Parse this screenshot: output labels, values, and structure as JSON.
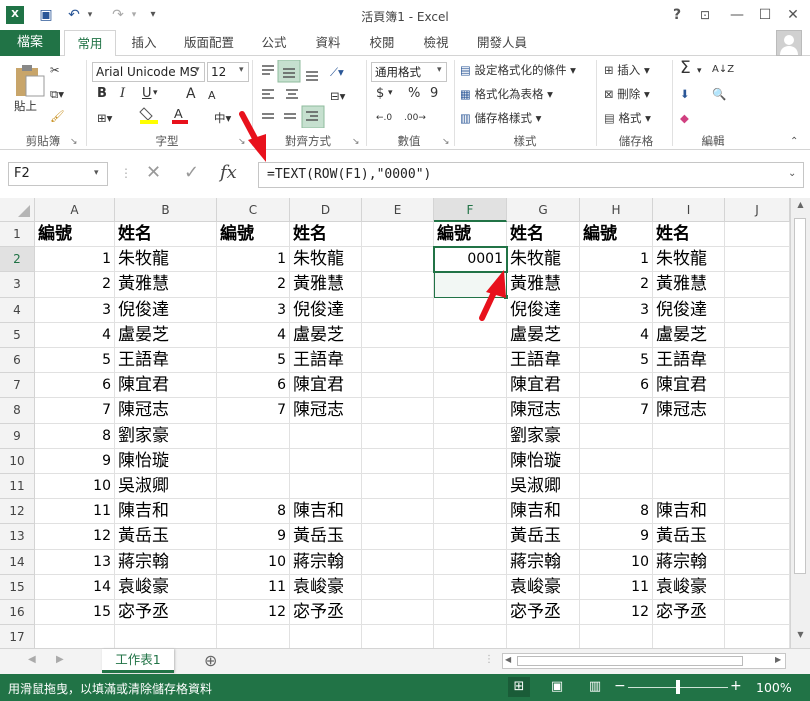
{
  "window": {
    "title": "活頁簿1 - Excel",
    "help": "?",
    "minimize": "—",
    "restore": "❐",
    "close": "✕"
  },
  "quick_access": {
    "save": "💾",
    "undo": "↶",
    "redo": "↷",
    "customize": "▾"
  },
  "ribbon_tabs": [
    {
      "label": "檔案"
    },
    {
      "label": "常用"
    },
    {
      "label": "插入"
    },
    {
      "label": "版面配置"
    },
    {
      "label": "公式"
    },
    {
      "label": "資料"
    },
    {
      "label": "校閱"
    },
    {
      "label": "檢視"
    },
    {
      "label": "開發人員"
    }
  ],
  "ribbon": {
    "clipboard": {
      "paste": "貼上",
      "group": "剪貼簿"
    },
    "font": {
      "name": "Arial Unicode MS",
      "size": "12",
      "bold": "B",
      "italic": "I",
      "underline": "U",
      "grow": "A",
      "shrink": "A",
      "group": "字型"
    },
    "alignment": {
      "group": "對齊方式"
    },
    "number": {
      "format": "通用格式",
      "currency": "$",
      "percent": "%",
      "comma": "9",
      "group": "數值"
    },
    "styles": {
      "conditional": "設定格式化的條件",
      "as_table": "格式化為表格",
      "cell_styles": "儲存格樣式",
      "group": "樣式"
    },
    "cells": {
      "insert": "插入",
      "delete": "刪除",
      "format": "格式",
      "group": "儲存格"
    },
    "editing": {
      "sum": "Σ",
      "sort": "A↓Z",
      "find": "🔍",
      "fill": "⬇",
      "clear": "◆",
      "group": "編輯"
    }
  },
  "formula_bar": {
    "name_box": "F2",
    "cancel": "✕",
    "enter": "✓",
    "fx": "fx",
    "formula": "=TEXT(ROW(F1),\"0000\")"
  },
  "columns": [
    "A",
    "B",
    "C",
    "D",
    "E",
    "F",
    "G",
    "H",
    "I",
    "J"
  ],
  "rows": [
    "1",
    "2",
    "3",
    "4",
    "5",
    "6",
    "7",
    "8",
    "9",
    "10",
    "11",
    "12",
    "13",
    "14",
    "15",
    "16",
    "17"
  ],
  "sheet": {
    "A": [
      "編號",
      "1",
      "2",
      "3",
      "4",
      "5",
      "6",
      "7",
      "8",
      "9",
      "10",
      "11",
      "12",
      "13",
      "14",
      "15",
      ""
    ],
    "B": [
      "姓名",
      "朱牧龍",
      "黃雅慧",
      "倪俊達",
      "盧晏芝",
      "王語韋",
      "陳宜君",
      "陳冠志",
      "劉家豪",
      "陳怡璇",
      "吳淑卿",
      "陳吉和",
      "黃岳玉",
      "蔣宗翰",
      "袁峻豪",
      "宓予丞",
      ""
    ],
    "C": [
      "編號",
      "1",
      "2",
      "3",
      "4",
      "5",
      "6",
      "7",
      "",
      "",
      "",
      "8",
      "9",
      "10",
      "11",
      "12",
      ""
    ],
    "D": [
      "姓名",
      "朱牧龍",
      "黃雅慧",
      "倪俊達",
      "盧晏芝",
      "王語韋",
      "陳宜君",
      "陳冠志",
      "",
      "",
      "",
      "陳吉和",
      "黃岳玉",
      "蔣宗翰",
      "袁峻豪",
      "宓予丞",
      ""
    ],
    "E": [
      "",
      "",
      "",
      "",
      "",
      "",
      "",
      "",
      "",
      "",
      "",
      "",
      "",
      "",
      "",
      "",
      ""
    ],
    "F": [
      "編號",
      "0001",
      "",
      "",
      "",
      "",
      "",
      "",
      "",
      "",
      "",
      "",
      "",
      "",
      "",
      "",
      ""
    ],
    "G": [
      "姓名",
      "朱牧龍",
      "黃雅慧",
      "倪俊達",
      "盧晏芝",
      "王語韋",
      "陳宜君",
      "陳冠志",
      "劉家豪",
      "陳怡璇",
      "吳淑卿",
      "陳吉和",
      "黃岳玉",
      "蔣宗翰",
      "袁峻豪",
      "宓予丞",
      ""
    ],
    "H": [
      "編號",
      "1",
      "2",
      "3",
      "4",
      "5",
      "6",
      "7",
      "",
      "",
      "",
      "8",
      "9",
      "10",
      "11",
      "12",
      ""
    ],
    "I": [
      "姓名",
      "朱牧龍",
      "黃雅慧",
      "倪俊達",
      "盧晏芝",
      "王語韋",
      "陳宜君",
      "陳冠志",
      "",
      "",
      "",
      "陳吉和",
      "黃岳玉",
      "蔣宗翰",
      "袁峻豪",
      "宓予丞",
      ""
    ],
    "J": [
      "",
      "",
      "",
      "",
      "",
      "",
      "",
      "",
      "",
      "",
      "",
      "",
      "",
      "",
      "",
      "",
      ""
    ]
  },
  "sheet_tabs": {
    "active": "工作表1",
    "add": "⊕"
  },
  "status": {
    "message": "用滑鼠拖曳，以填滿或清除儲存格資料",
    "zoom": "100%",
    "zoom_minus": "−",
    "zoom_plus": "+"
  },
  "colors": {
    "accent": "#217346",
    "arrow": "#e8111c",
    "selection": "#217346"
  }
}
